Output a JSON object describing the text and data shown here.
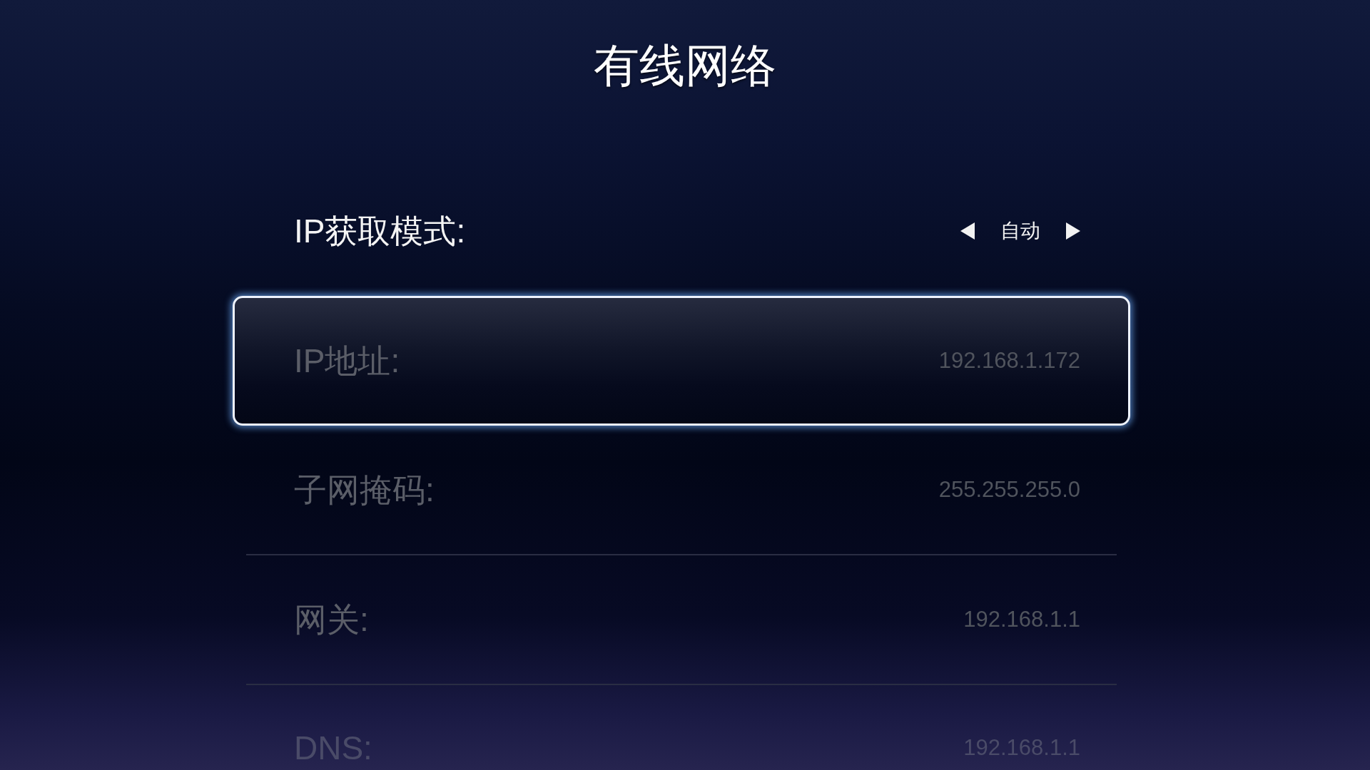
{
  "title": "有线网络",
  "settings": [
    {
      "kind": "selector",
      "label": "IP获取模式:",
      "value": "自动",
      "selected": false,
      "disabled": false
    },
    {
      "kind": "field",
      "label": "IP地址:",
      "value": "192.168.1.172",
      "selected": true,
      "disabled": true
    },
    {
      "kind": "field",
      "label": "子网掩码:",
      "value": "255.255.255.0",
      "selected": false,
      "disabled": true
    },
    {
      "kind": "field",
      "label": "网关:",
      "value": "192.168.1.1",
      "selected": false,
      "disabled": true
    },
    {
      "kind": "field",
      "label": "DNS:",
      "value": "192.168.1.1",
      "selected": false,
      "disabled": true
    }
  ]
}
